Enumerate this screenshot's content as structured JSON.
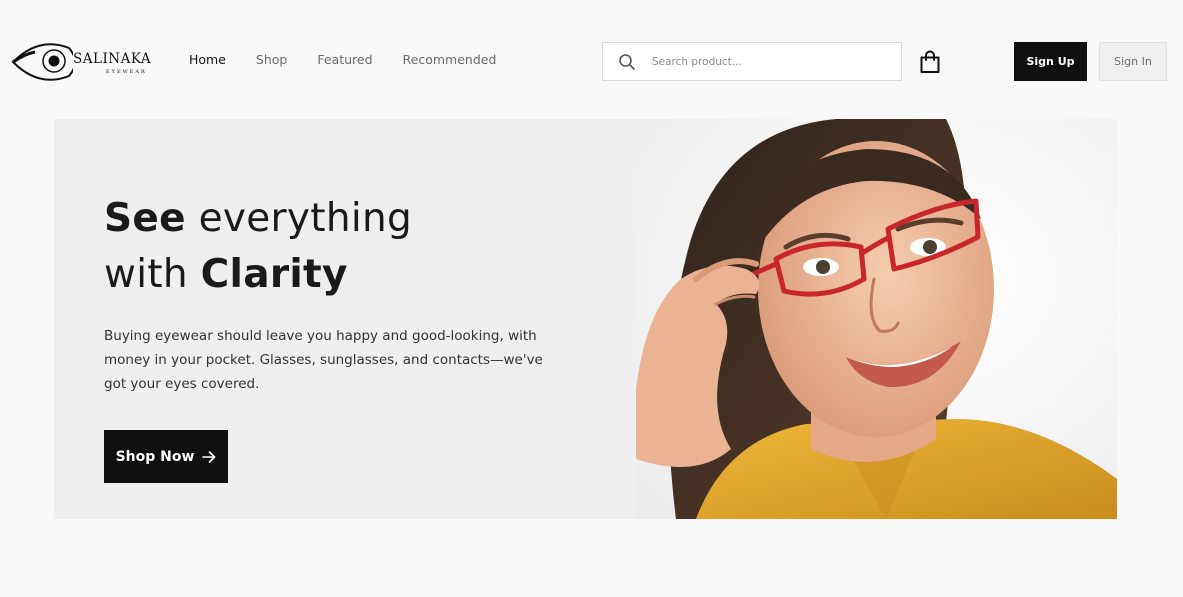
{
  "brand": {
    "name": "SALINAKA",
    "tagline": "EYEWEAR"
  },
  "nav": {
    "items": [
      {
        "label": "Home",
        "active": true
      },
      {
        "label": "Shop",
        "active": false
      },
      {
        "label": "Featured",
        "active": false
      },
      {
        "label": "Recommended",
        "active": false
      }
    ]
  },
  "search": {
    "placeholder": "Search product...",
    "value": "",
    "icon": "search-icon"
  },
  "cart": {
    "icon": "shopping-bag-icon"
  },
  "auth": {
    "signup_label": "Sign Up",
    "signin_label": "Sign In"
  },
  "hero": {
    "title_bold_1": "See",
    "title_regular_1": " everything",
    "title_regular_2": "with ",
    "title_bold_2": "Clarity",
    "description": "Buying eyewear should leave you happy and good-looking, with money in your pocket. Glasses, sunglasses, and contacts—we've got your eyes covered.",
    "cta_label": "Shop Now",
    "cta_icon": "arrow-right-icon",
    "image_subject": "woman-wearing-red-glasses"
  },
  "colors": {
    "accent": "#101010",
    "background": "#f8f8f8",
    "hero_background": "#efefef",
    "glasses_frame": "#c8262a",
    "shirt": "#e1a52c"
  }
}
